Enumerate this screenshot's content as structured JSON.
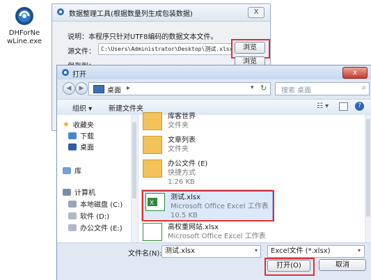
{
  "desktop_icon": {
    "label_line1": "DHForNe",
    "label_line2": "wLine.exe"
  },
  "tool_dialog": {
    "title": "数据整理工具(根据数量列生成包装数据)",
    "close_label": "X",
    "description": "说明：本程序只针对UTF8编码的数据文本文件。",
    "source_label": "源文件：",
    "source_value": "C:\\Users\\Administrator\\Desktop\\测试.xlsx",
    "save_label": "保存到：",
    "browse1": "浏览",
    "browse2": "浏览"
  },
  "open_dialog": {
    "title": "打开",
    "close_label": "x",
    "address": "桌面",
    "address_arrow": "▸",
    "search_placeholder": "搜索 桌面",
    "toolbar": {
      "organize": "组织 ▾",
      "new_folder": "新建文件夹"
    },
    "sidebar": [
      {
        "label": "收藏夹"
      },
      {
        "label": "下载"
      },
      {
        "label": "桌面"
      },
      {
        "label": "库"
      },
      {
        "label": "计算机"
      },
      {
        "label": "本地磁盘 (C:)"
      },
      {
        "label": "软件 (D:)"
      },
      {
        "label": "办公文件 (E:)"
      }
    ],
    "files": [
      {
        "name": "库客世界",
        "type": "文件夹",
        "size": ""
      },
      {
        "name": "文章列表",
        "type": "文件夹",
        "size": ""
      },
      {
        "name": "办公文件 (E)",
        "type": "快捷方式",
        "size": "1.26 KB"
      },
      {
        "name": "测试.xlsx",
        "type": "Microsoft Office Excel 工作表",
        "size": "10.5 KB"
      },
      {
        "name": "高权重网站.xlsx",
        "type": "Microsoft Office Excel 工作表",
        "size": ""
      }
    ],
    "filename_label": "文件名(N):",
    "filename_value": "测试.xlsx",
    "filetype_value": "Excel文件 (*.xlsx)",
    "open_button": "打开(O)",
    "cancel_button": "取消"
  }
}
